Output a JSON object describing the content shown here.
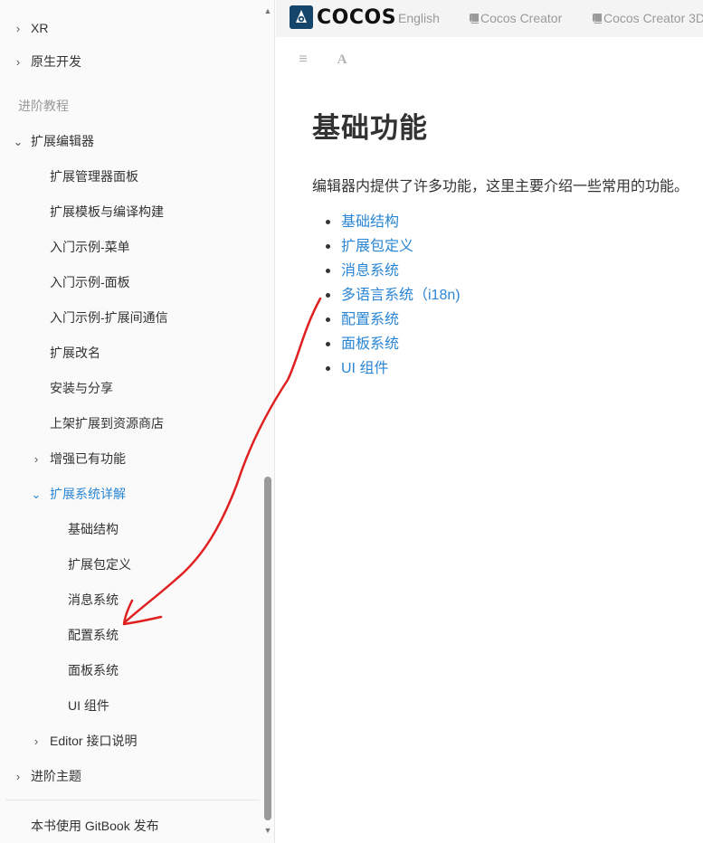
{
  "sidebar": {
    "items": [
      {
        "label": "XR",
        "chevron": "›"
      },
      {
        "label": "原生开发",
        "chevron": "›"
      },
      {
        "label": "扩展编辑器",
        "chevron": "⌄"
      },
      {
        "label": "扩展管理器面板"
      },
      {
        "label": "扩展模板与编译构建"
      },
      {
        "label": "入门示例-菜单"
      },
      {
        "label": "入门示例-面板"
      },
      {
        "label": "入门示例-扩展间通信"
      },
      {
        "label": "扩展改名"
      },
      {
        "label": "安装与分享"
      },
      {
        "label": "上架扩展到资源商店"
      },
      {
        "label": "增强已有功能",
        "chevron": "›"
      },
      {
        "label": "扩展系统详解",
        "chevron": "⌄",
        "active": true
      },
      {
        "label": "基础结构"
      },
      {
        "label": "扩展包定义"
      },
      {
        "label": "消息系统"
      },
      {
        "label": "配置系统"
      },
      {
        "label": "面板系统"
      },
      {
        "label": "UI 组件"
      },
      {
        "label": "Editor 接口说明",
        "chevron": "›"
      },
      {
        "label": "进阶主题",
        "chevron": "›"
      }
    ],
    "section_header": "进阶教程",
    "footer_link": "本书使用 GitBook 发布",
    "scroll_up_icon": "▲",
    "scroll_down_icon": "▼"
  },
  "topbar": {
    "logo_text": "COCOS",
    "links": [
      "English",
      "Cocos Creator",
      "Cocos Creator 3D"
    ]
  },
  "toolbar": {
    "menu_icon": "≡",
    "font_icon": "A"
  },
  "main": {
    "title": "基础功能",
    "intro": "编辑器内提供了许多功能，这里主要介绍一些常用的功能。",
    "links": [
      "基础结构",
      "扩展包定义",
      "消息系统",
      "多语言系统（i18n)",
      "配置系统",
      "面板系统",
      "UI 组件"
    ]
  },
  "colors": {
    "link": "#2a86d4",
    "annotation": "#e02020",
    "sidebar_bg": "#fafafa",
    "topbar_bg": "#f4f4f4"
  }
}
